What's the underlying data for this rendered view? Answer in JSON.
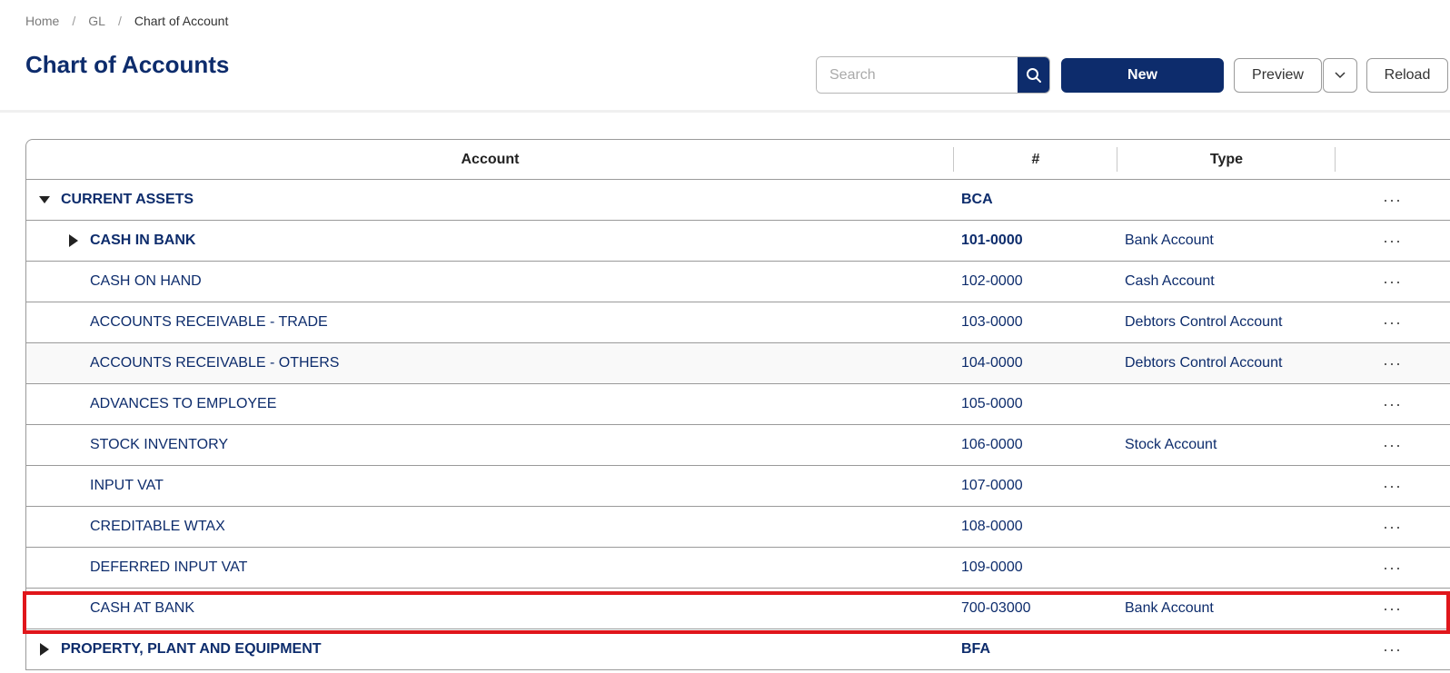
{
  "breadcrumb": {
    "items": [
      "Home",
      "GL",
      "Chart of Account"
    ]
  },
  "page": {
    "title": "Chart of Accounts"
  },
  "toolbar": {
    "search_placeholder": "Search",
    "new_label": "New",
    "preview_label": "Preview",
    "reload_label": "Reload"
  },
  "table": {
    "columns": [
      "Account",
      "#",
      "Type",
      ""
    ],
    "rows": [
      {
        "level": 0,
        "toggle": "expanded",
        "bold": true,
        "account": "CURRENT ASSETS",
        "code": "BCA",
        "type": "",
        "menu": "···"
      },
      {
        "level": 1,
        "toggle": "collapsed",
        "bold": true,
        "account": "CASH IN BANK",
        "code": "101-0000",
        "type": "Bank Account",
        "menu": "···"
      },
      {
        "level": 1,
        "toggle": "none",
        "bold": false,
        "account": "CASH ON HAND",
        "code": "102-0000",
        "type": "Cash Account",
        "menu": "···"
      },
      {
        "level": 1,
        "toggle": "none",
        "bold": false,
        "account": "ACCOUNTS RECEIVABLE - TRADE",
        "code": "103-0000",
        "type": "Debtors Control Account",
        "menu": "···"
      },
      {
        "level": 1,
        "toggle": "none",
        "bold": false,
        "account": "ACCOUNTS RECEIVABLE - OTHERS",
        "code": "104-0000",
        "type": "Debtors Control Account",
        "menu": "···"
      },
      {
        "level": 1,
        "toggle": "none",
        "bold": false,
        "account": "ADVANCES TO EMPLOYEE",
        "code": "105-0000",
        "type": "",
        "menu": "···"
      },
      {
        "level": 1,
        "toggle": "none",
        "bold": false,
        "account": "STOCK INVENTORY",
        "code": "106-0000",
        "type": "Stock Account",
        "menu": "···"
      },
      {
        "level": 1,
        "toggle": "none",
        "bold": false,
        "account": "INPUT VAT",
        "code": "107-0000",
        "type": "",
        "menu": "···"
      },
      {
        "level": 1,
        "toggle": "none",
        "bold": false,
        "account": "CREDITABLE WTAX",
        "code": "108-0000",
        "type": "",
        "menu": "···"
      },
      {
        "level": 1,
        "toggle": "none",
        "bold": false,
        "account": "DEFERRED INPUT VAT",
        "code": "109-0000",
        "type": "",
        "menu": "···"
      },
      {
        "level": 1,
        "toggle": "none",
        "bold": false,
        "account": "CASH AT BANK",
        "code": "700-03000",
        "type": "Bank Account",
        "menu": "···",
        "highlighted": true
      },
      {
        "level": 0,
        "toggle": "collapsed",
        "bold": true,
        "account": "PROPERTY, PLANT AND EQUIPMENT",
        "code": "BFA",
        "type": "",
        "menu": "···"
      }
    ]
  },
  "colors": {
    "primary": "#0d2c6c",
    "highlight": "#e0161b"
  },
  "icons": {
    "search": "search-icon",
    "caret": "chevron-down-icon",
    "expanded": "caret-down-icon",
    "collapsed": "caret-right-icon",
    "menu": "more-horizontal-icon"
  }
}
